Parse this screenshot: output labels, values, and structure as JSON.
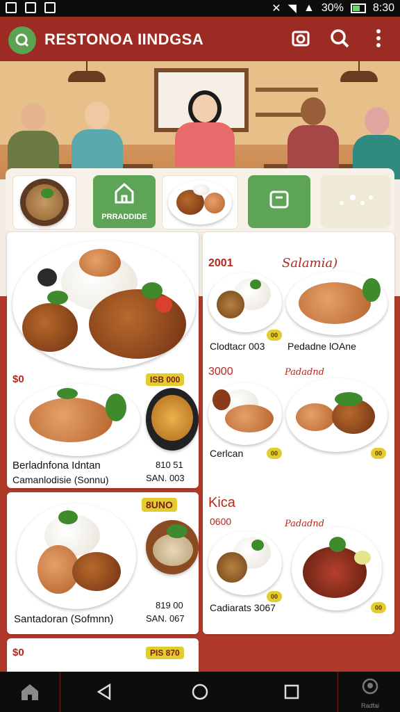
{
  "status_bar": {
    "battery_text": "30%",
    "time": "8:30"
  },
  "app_bar": {
    "title": "RESTONOA IINDGSA",
    "icons": [
      "camera-icon",
      "search-icon",
      "more-vert-icon"
    ]
  },
  "categories": [
    {
      "label": ""
    },
    {
      "label": "PRRADDIDE"
    },
    {
      "label": ""
    },
    {
      "label": ""
    },
    {
      "label": ""
    }
  ],
  "featured": {
    "price_left": "$0",
    "price_tag": "ISB 000",
    "name": "Berladnfona Idntan",
    "subtitle": "Camanlodisie (Sonnu)",
    "price_line1": "810 51",
    "price_line2": "SAN. 003"
  },
  "second_card": {
    "price_tag": "8UNO",
    "name": "Santadoran (Sofmnn)",
    "price_line1": "819 00",
    "price_line2": "SAN. 067"
  },
  "third_card": {
    "price_left": "$0",
    "price_tag": "PIS 870"
  },
  "right_column": [
    {
      "heading_left": "2001",
      "heading_right": "Salamia)",
      "item_left": "Clodtacr  003",
      "item_right": "Pedadne lOAne",
      "badge_left": "00"
    },
    {
      "heading_left": "3000",
      "heading_right": "Padadnd",
      "item_left": "Cerlcan",
      "badge_left": "00",
      "badge_right": "00"
    },
    {
      "heading_left": "Kica",
      "heading_sub": "0600",
      "heading_right": "Padadnd",
      "item_left": "Cadiarats 3067",
      "badge_left": "00",
      "badge_right": "00"
    }
  ],
  "nav": {
    "right_label": "Radfai"
  },
  "colors": {
    "appbar": "#9c2c23",
    "accent_green": "#5ea457",
    "tag_yellow": "#e2cc2e"
  }
}
